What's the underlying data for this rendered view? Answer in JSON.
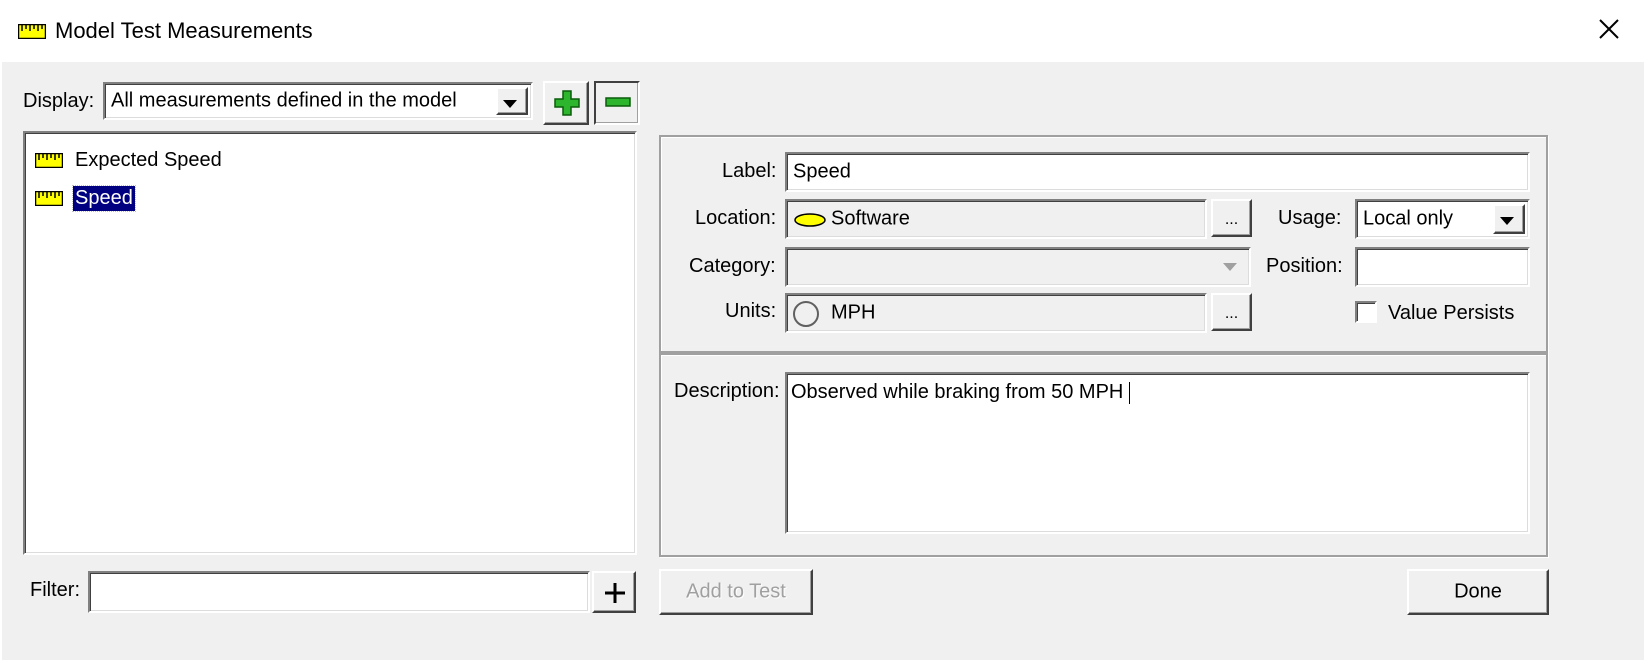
{
  "window": {
    "title": "Model Test Measurements",
    "title_icon": "ruler-icon",
    "close_icon": "close-icon"
  },
  "display": {
    "label": "Display:",
    "selected": "All measurements defined in the model",
    "add_icon": "green-plus-icon",
    "remove_icon": "green-minus-icon"
  },
  "tree": {
    "items": [
      {
        "label": "Expected Speed",
        "icon": "ruler-icon",
        "selected": false
      },
      {
        "label": "Speed",
        "icon": "ruler-icon",
        "selected": true
      }
    ]
  },
  "filter": {
    "label": "Filter:",
    "value": "",
    "add_icon": "plus-icon"
  },
  "details": {
    "label_caption": "Label:",
    "label_value": "Speed",
    "location_caption": "Location:",
    "location_value": "Software",
    "location_icon": "yellow-oval-icon",
    "location_browse": "...",
    "usage_caption": "Usage:",
    "usage_value": "Local only",
    "category_caption": "Category:",
    "category_value": "",
    "position_caption": "Position:",
    "position_value": "",
    "units_caption": "Units:",
    "units_value": "MPH",
    "units_icon": "circle-icon",
    "units_browse": "...",
    "value_persists_label": "Value Persists",
    "value_persists_checked": false,
    "description_caption": "Description:",
    "description_value": "Observed while braking from 50 MPH"
  },
  "buttons": {
    "add_to_test": "Add to Test",
    "done": "Done"
  },
  "colors": {
    "selection": "#000080",
    "ruler_yellow": "#ffff00",
    "plus_green": "#2db52d",
    "dialog_bg": "#f0f0f0"
  }
}
